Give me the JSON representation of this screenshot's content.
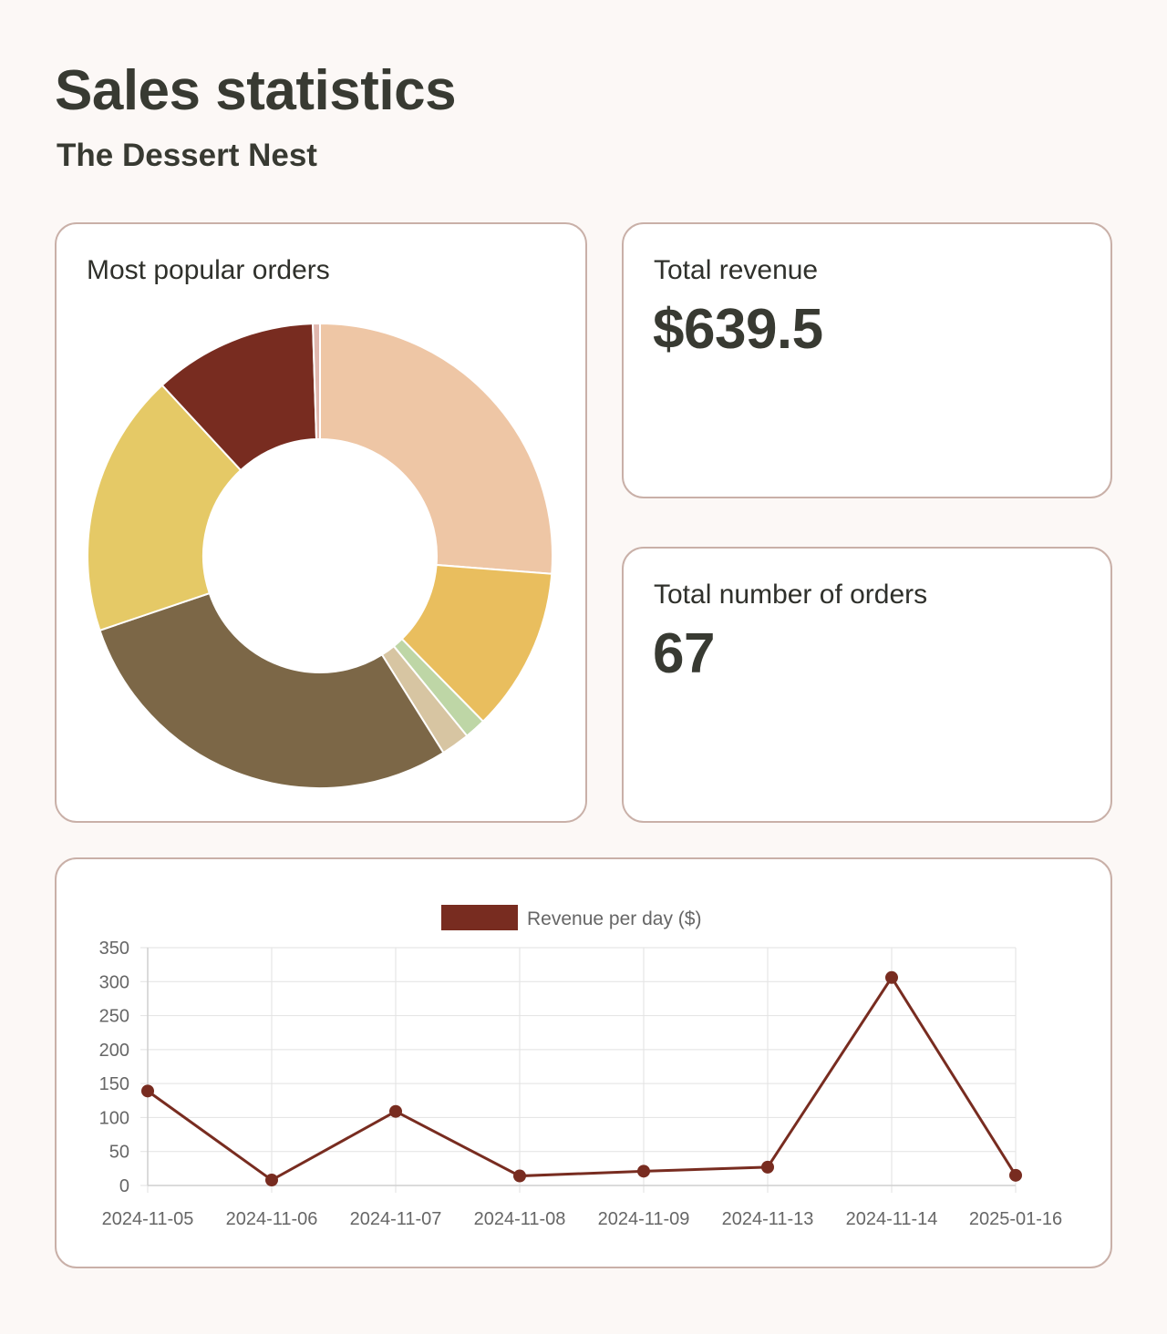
{
  "header": {
    "title": "Sales statistics",
    "subtitle": "The Dessert Nest"
  },
  "popular_orders": {
    "label": "Most popular orders"
  },
  "revenue": {
    "label": "Total revenue",
    "value": "$639.5"
  },
  "orders": {
    "label": "Total number of orders",
    "value": "67"
  },
  "colors": {
    "accent": "#782c20",
    "card_border": "#c9b0a8",
    "background": "#fcf8f6",
    "text": "#383a32"
  },
  "chart_data": [
    {
      "type": "pie",
      "title": "Most popular orders",
      "donut": true,
      "values": [
        26.5,
        11.5,
        1.5,
        2,
        29,
        18.5,
        11.5,
        0.5
      ],
      "colors": [
        "#eec6a5",
        "#e9be5e",
        "#bed6a6",
        "#d7c5a2",
        "#7c6747",
        "#e5c966",
        "#782c20",
        "#e0b7ae"
      ]
    },
    {
      "type": "line",
      "categories": [
        "2024-11-05",
        "2024-11-06",
        "2024-11-07",
        "2024-11-08",
        "2024-11-09",
        "2024-11-13",
        "2024-11-14",
        "2025-01-16"
      ],
      "series": [
        {
          "name": "Revenue per day ($)",
          "values": [
            139,
            8,
            109,
            14,
            21,
            27,
            306,
            15
          ],
          "color": "#782c20"
        }
      ],
      "ylim": [
        0,
        350
      ],
      "yticks": [
        0,
        50,
        100,
        150,
        200,
        250,
        300,
        350
      ],
      "grid": true,
      "legend": "top-center"
    }
  ]
}
